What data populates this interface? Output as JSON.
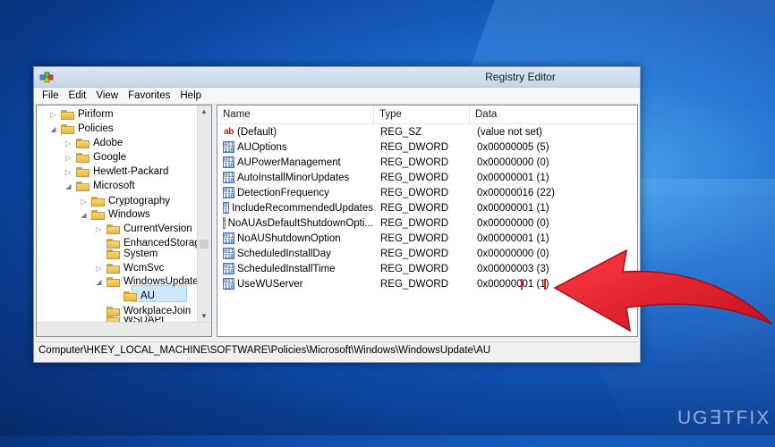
{
  "window": {
    "title": "Registry Editor"
  },
  "menu": [
    "File",
    "Edit",
    "View",
    "Favorites",
    "Help"
  ],
  "tree": [
    {
      "label": "Piriform",
      "expander": "▷"
    },
    {
      "label": "Policies",
      "expander": "◢"
    },
    {
      "label": "Adobe",
      "expander": "▷"
    },
    {
      "label": "Google",
      "expander": "▷"
    },
    {
      "label": "Hewlett-Packard",
      "expander": "▷"
    },
    {
      "label": "Microsoft",
      "expander": "◢"
    },
    {
      "label": "Cryptography",
      "expander": "▷"
    },
    {
      "label": "Windows",
      "expander": "◢"
    },
    {
      "label": "CurrentVersion",
      "expander": "▷"
    },
    {
      "label": "EnhancedStorage",
      "expander": ""
    },
    {
      "label": "System",
      "expander": ""
    },
    {
      "label": "WcmSvc",
      "expander": "▷"
    },
    {
      "label": "WindowsUpdate",
      "expander": "◢"
    },
    {
      "label": "AU",
      "expander": ""
    },
    {
      "label": "WorkplaceJoin",
      "expander": ""
    },
    {
      "label": "WSDAPI",
      "expander": ""
    }
  ],
  "list": {
    "headers": {
      "name": "Name",
      "type": "Type",
      "data": "Data"
    },
    "rows": [
      {
        "name": "(Default)",
        "type": "REG_SZ",
        "data": "(value not set)",
        "icon": "string-value-icon"
      },
      {
        "name": "AUOptions",
        "type": "REG_DWORD",
        "data": "0x00000005 (5)",
        "icon": "dword-value-icon"
      },
      {
        "name": "AUPowerManagement",
        "type": "REG_DWORD",
        "data": "0x00000000 (0)",
        "icon": "dword-value-icon"
      },
      {
        "name": "AutoInstallMinorUpdates",
        "type": "REG_DWORD",
        "data": "0x00000001 (1)",
        "icon": "dword-value-icon"
      },
      {
        "name": "DetectionFrequency",
        "type": "REG_DWORD",
        "data": "0x00000016 (22)",
        "icon": "dword-value-icon"
      },
      {
        "name": "IncludeRecommendedUpdates",
        "type": "REG_DWORD",
        "data": "0x00000001 (1)",
        "icon": "dword-value-icon"
      },
      {
        "name": "NoAUAsDefaultShutdownOpti...",
        "type": "REG_DWORD",
        "data": "0x00000000 (0)",
        "icon": "dword-value-icon"
      },
      {
        "name": "NoAUShutdownOption",
        "type": "REG_DWORD",
        "data": "0x00000001 (1)",
        "icon": "dword-value-icon"
      },
      {
        "name": "ScheduledInstallDay",
        "type": "REG_DWORD",
        "data": "0x00000000 (0)",
        "icon": "dword-value-icon"
      },
      {
        "name": "ScheduledInstallTime",
        "type": "REG_DWORD",
        "data": "0x00000003 (3)",
        "icon": "dword-value-icon"
      },
      {
        "name": "UseWUServer",
        "type": "REG_DWORD",
        "data": "0x00000001 (1)",
        "icon": "dword-value-icon"
      }
    ]
  },
  "status": "Computer\\HKEY_LOCAL_MACHINE\\SOFTWARE\\Policies\\Microsoft\\Windows\\WindowsUpdate\\AU",
  "watermark": "UG∃TFIX",
  "colors": {
    "highlight": "#e02020",
    "arrow": "#e0202e",
    "selection": "#cce8ff"
  }
}
